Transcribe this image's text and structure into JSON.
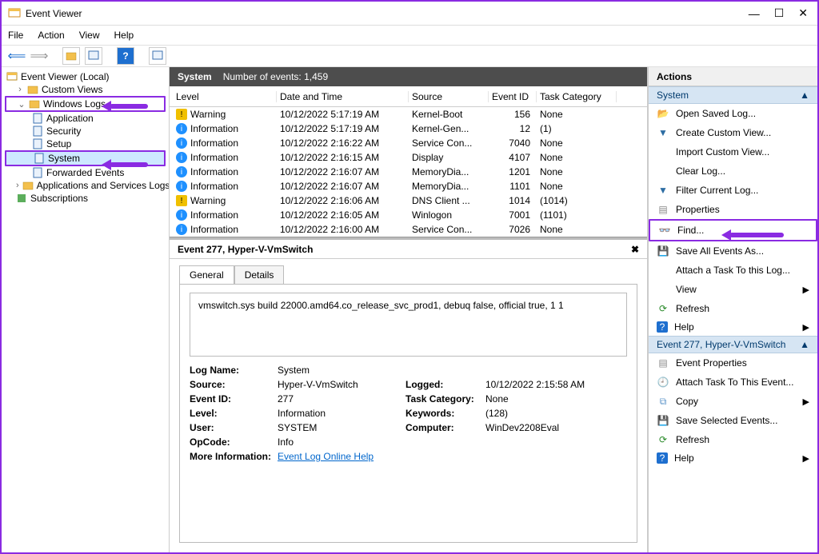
{
  "title": "Event Viewer",
  "menu": {
    "file": "File",
    "action": "Action",
    "view": "View",
    "help": "Help"
  },
  "tree": {
    "root": "Event Viewer (Local)",
    "custom": "Custom Views",
    "winlogs": "Windows Logs",
    "app": "Application",
    "sec": "Security",
    "setup": "Setup",
    "system": "System",
    "fwd": "Forwarded Events",
    "apps_svc": "Applications and Services Logs",
    "subs": "Subscriptions"
  },
  "gridHeader": {
    "title": "System",
    "count_label": "Number of events: 1,459"
  },
  "columns": {
    "level": "Level",
    "date": "Date and Time",
    "source": "Source",
    "eid": "Event ID",
    "task": "Task Category"
  },
  "rows": [
    {
      "level": "Warning",
      "icon": "warn",
      "date": "10/12/2022 5:17:19 AM",
      "source": "Kernel-Boot",
      "eid": "156",
      "task": "None"
    },
    {
      "level": "Information",
      "icon": "info",
      "date": "10/12/2022 5:17:19 AM",
      "source": "Kernel-Gen...",
      "eid": "12",
      "task": "(1)"
    },
    {
      "level": "Information",
      "icon": "info",
      "date": "10/12/2022 2:16:22 AM",
      "source": "Service Con...",
      "eid": "7040",
      "task": "None"
    },
    {
      "level": "Information",
      "icon": "info",
      "date": "10/12/2022 2:16:15 AM",
      "source": "Display",
      "eid": "4107",
      "task": "None"
    },
    {
      "level": "Information",
      "icon": "info",
      "date": "10/12/2022 2:16:07 AM",
      "source": "MemoryDia...",
      "eid": "1201",
      "task": "None"
    },
    {
      "level": "Information",
      "icon": "info",
      "date": "10/12/2022 2:16:07 AM",
      "source": "MemoryDia...",
      "eid": "1101",
      "task": "None"
    },
    {
      "level": "Warning",
      "icon": "warn",
      "date": "10/12/2022 2:16:06 AM",
      "source": "DNS Client ...",
      "eid": "1014",
      "task": "(1014)"
    },
    {
      "level": "Information",
      "icon": "info",
      "date": "10/12/2022 2:16:05 AM",
      "source": "Winlogon",
      "eid": "7001",
      "task": "(1101)"
    },
    {
      "level": "Information",
      "icon": "info",
      "date": "10/12/2022 2:16:00 AM",
      "source": "Service Con...",
      "eid": "7026",
      "task": "None"
    }
  ],
  "detail": {
    "title": "Event 277, Hyper-V-VmSwitch",
    "tabs": {
      "general": "General",
      "details": "Details"
    },
    "message": "vmswitch.sys build 22000.amd64.co_release_svc_prod1, debuq false, official true, 1 1",
    "kv": {
      "logname_k": "Log Name:",
      "logname_v": "System",
      "source_k": "Source:",
      "source_v": "Hyper-V-VmSwitch",
      "logged_k": "Logged:",
      "logged_v": "10/12/2022 2:15:58 AM",
      "eid_k": "Event ID:",
      "eid_v": "277",
      "taskcat_k": "Task Category:",
      "taskcat_v": "None",
      "level_k": "Level:",
      "level_v": "Information",
      "keywords_k": "Keywords:",
      "keywords_v": "(128)",
      "user_k": "User:",
      "user_v": "SYSTEM",
      "computer_k": "Computer:",
      "computer_v": "WinDev2208Eval",
      "opcode_k": "OpCode:",
      "opcode_v": "Info",
      "more_k": "More Information:",
      "more_v": "Event Log Online Help"
    }
  },
  "actions": {
    "header": "Actions",
    "section1": "System",
    "items1": {
      "open": "Open Saved Log...",
      "create": "Create Custom View...",
      "import": "Import Custom View...",
      "clear": "Clear Log...",
      "filter": "Filter Current Log...",
      "props": "Properties",
      "find": "Find...",
      "saveall": "Save All Events As...",
      "attach": "Attach a Task To this Log...",
      "view": "View",
      "refresh": "Refresh",
      "help": "Help"
    },
    "section2": "Event 277, Hyper-V-VmSwitch",
    "items2": {
      "evprops": "Event Properties",
      "attachev": "Attach Task To This Event...",
      "copy": "Copy",
      "savesel": "Save Selected Events...",
      "refresh": "Refresh",
      "help": "Help"
    }
  }
}
